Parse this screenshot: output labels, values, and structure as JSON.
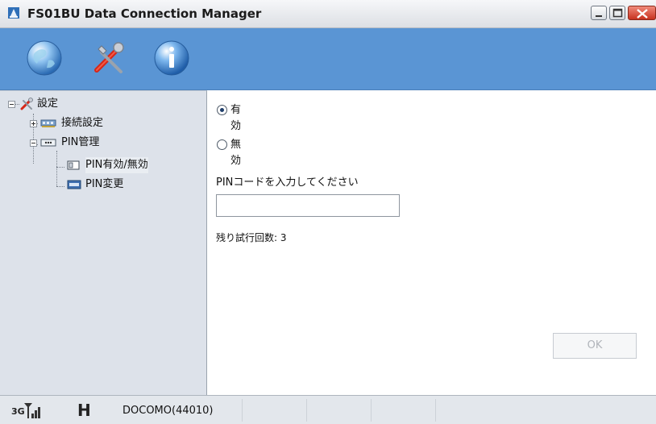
{
  "window": {
    "title": "FS01BU Data Connection Manager",
    "colors": {
      "toolbar": "#5a95d4",
      "tree_bg": "#dde2ea",
      "close_red": "#c7321f"
    }
  },
  "toolbar": {
    "buttons": [
      {
        "icon": "globe-icon"
      },
      {
        "icon": "tools-icon"
      },
      {
        "icon": "info-icon"
      }
    ]
  },
  "tree": {
    "root": {
      "label": "設定",
      "icon": "tools-icon",
      "expanded": true
    },
    "items": [
      {
        "label": "接続設定",
        "icon": "network-card-icon",
        "expanded": false
      },
      {
        "label": "PIN管理",
        "icon": "pin-card-icon",
        "expanded": true
      },
      {
        "label": "PIN有効/無効",
        "icon": "pin-lock-icon",
        "selected": true
      },
      {
        "label": "PIN変更",
        "icon": "pin-change-icon"
      }
    ]
  },
  "content": {
    "radio_enable": {
      "label": "有効",
      "checked": true
    },
    "radio_disable": {
      "label": "無効",
      "checked": false
    },
    "pin_label": "PINコードを入力してください",
    "pin_value": "",
    "remaining": "残り試行回数: 3",
    "ok_label": "OK"
  },
  "status": {
    "network_type": "3G",
    "mode": "H",
    "carrier": "DOCOMO(44010)"
  }
}
